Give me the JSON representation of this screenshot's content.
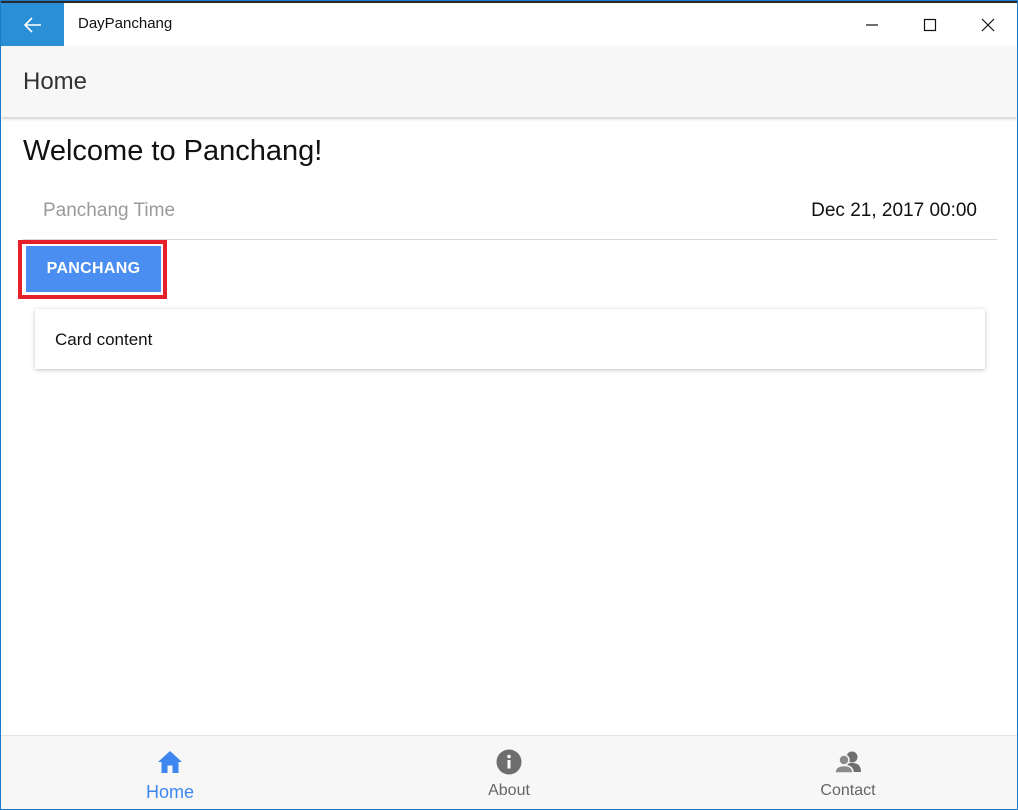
{
  "window": {
    "title": "DayPanchang"
  },
  "header": {
    "title": "Home"
  },
  "main": {
    "welcome": "Welcome to Panchang!",
    "time_label": "Panchang Time",
    "time_value": "Dec 21, 2017 00:00",
    "button_label": "PANCHANG",
    "card_text": "Card content"
  },
  "tabs": [
    {
      "label": "Home",
      "icon": "home-icon",
      "selected": true
    },
    {
      "label": "About",
      "icon": "info-icon",
      "selected": false
    },
    {
      "label": "Contact",
      "icon": "contacts-icon",
      "selected": false
    }
  ],
  "colors": {
    "accent": "#4a8ef2",
    "tab_selected": "#3d86f0",
    "highlight_border": "#e5202b",
    "titlebar_back": "#2b8fd6"
  }
}
